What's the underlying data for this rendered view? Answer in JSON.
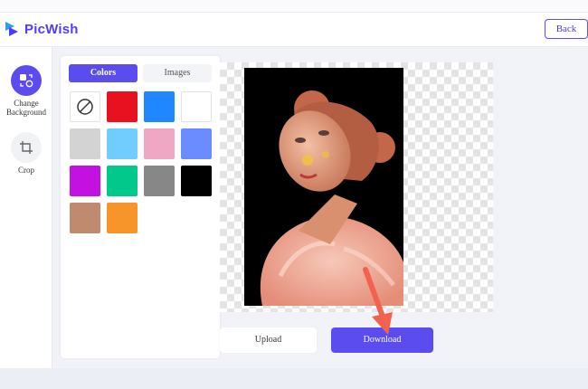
{
  "header": {
    "brand": "PicWish",
    "back_label": "Back"
  },
  "sidebar": {
    "tools": [
      {
        "label_line1": "Change",
        "label_line2": "Background",
        "icon": "change-background-icon",
        "active": true
      },
      {
        "label_line1": "Crop",
        "label_line2": "",
        "icon": "crop-icon",
        "active": false
      }
    ]
  },
  "panel": {
    "tabs": [
      {
        "label": "Colors",
        "active": true
      },
      {
        "label": "Images",
        "active": false
      }
    ],
    "swatches": [
      {
        "name": "none",
        "color": "#ffffff"
      },
      {
        "name": "red",
        "color": "#e8111f"
      },
      {
        "name": "blue",
        "color": "#1f87ff"
      },
      {
        "name": "white",
        "color": "#ffffff"
      },
      {
        "name": "light-gray",
        "color": "#d3d3d3"
      },
      {
        "name": "sky-blue",
        "color": "#70cdfd"
      },
      {
        "name": "pink",
        "color": "#f0a7c4"
      },
      {
        "name": "periwinkle",
        "color": "#6a8cff"
      },
      {
        "name": "purple",
        "color": "#c211e0"
      },
      {
        "name": "green",
        "color": "#00c98b"
      },
      {
        "name": "gray",
        "color": "#878787"
      },
      {
        "name": "black",
        "color": "#000000"
      },
      {
        "name": "tan",
        "color": "#c08a6f"
      },
      {
        "name": "orange",
        "color": "#f7942a"
      }
    ]
  },
  "actions": {
    "upload_label": "Upload",
    "download_label": "Download"
  },
  "colors": {
    "accent": "#5b4cf0",
    "arrow": "#f2624f"
  }
}
